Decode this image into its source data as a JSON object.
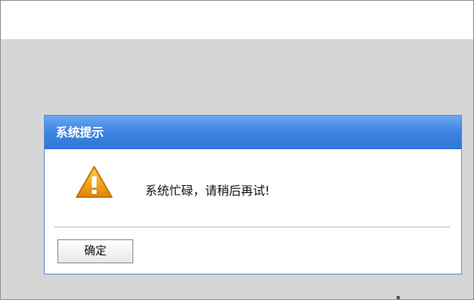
{
  "dialog": {
    "title": "系统提示",
    "message": "系统忙碌，请稍后再试!",
    "icon": "warning-icon",
    "ok_label": "确定"
  },
  "colors": {
    "overlay": "#d6d6d6",
    "titlebar": "#3f86e3",
    "border": "#5a8fd6",
    "warning": "#f5a623"
  }
}
